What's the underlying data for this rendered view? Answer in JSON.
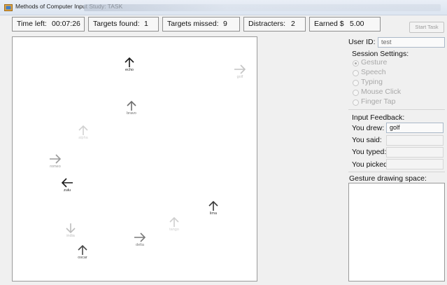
{
  "window": {
    "title": "Methods of Computer Input Study: TASK"
  },
  "stats": {
    "time_left_label": "Time left:",
    "time_left_value": "00:07:26",
    "targets_found_label": "Targets found:",
    "targets_found_value": "1",
    "targets_missed_label": "Targets missed:",
    "targets_missed_value": "9",
    "distracters_label": "Distracters:",
    "distracters_value": "2",
    "earned_label": "Earned $",
    "earned_value": "5.00"
  },
  "start_button": {
    "label": "Start Task"
  },
  "user": {
    "label": "User ID:",
    "value": "test"
  },
  "session_settings": {
    "title": "Session Settings:",
    "options": [
      {
        "label": "Gesture",
        "checked": true
      },
      {
        "label": "Speech",
        "checked": false
      },
      {
        "label": "Typing",
        "checked": false
      },
      {
        "label": "Mouse Click",
        "checked": false
      },
      {
        "label": "Finger Tap",
        "checked": false
      }
    ]
  },
  "input_feedback": {
    "title": "Input Feedback:",
    "drew_label": "You drew:",
    "drew_value": "golf",
    "said_label": "You said:",
    "said_value": "",
    "typed_label": "You typed:",
    "typed_value": "",
    "picked_label": "You picked:",
    "picked_value": ""
  },
  "gesture_space": {
    "label": "Gesture drawing space:"
  },
  "targets": [
    {
      "word": "echo",
      "direction": "up",
      "shade": "#1a1a1a"
    },
    {
      "word": "golf",
      "direction": "right",
      "shade": "#c4c4c4"
    },
    {
      "word": "bravo",
      "direction": "up",
      "shade": "#6e6e6e"
    },
    {
      "word": "alpha",
      "direction": "up",
      "shade": "#d2d2d2"
    },
    {
      "word": "romeo",
      "direction": "right",
      "shade": "#9a9a9a"
    },
    {
      "word": "zulu",
      "direction": "left",
      "shade": "#1a1a1a"
    },
    {
      "word": "lima",
      "direction": "up",
      "shade": "#3a3a3a"
    },
    {
      "word": "tango",
      "direction": "up",
      "shade": "#cfcfcf"
    },
    {
      "word": "delta",
      "direction": "right",
      "shade": "#7a7a7a"
    },
    {
      "word": "india",
      "direction": "down",
      "shade": "#bdbdbd"
    },
    {
      "word": "oscar",
      "direction": "up",
      "shade": "#4a4a4a"
    }
  ]
}
